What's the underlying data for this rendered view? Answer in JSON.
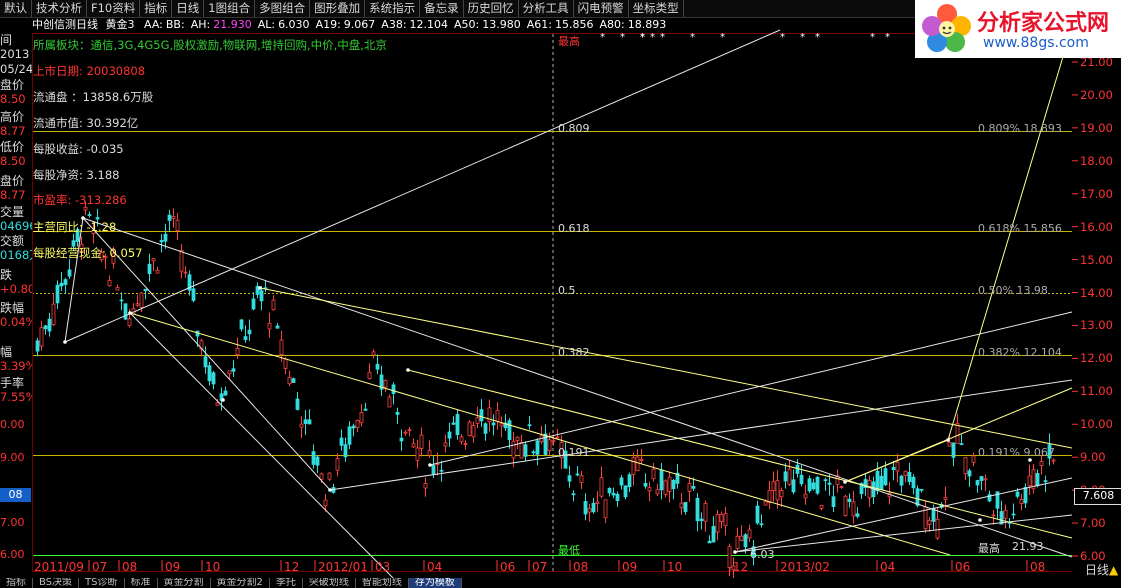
{
  "menu": [
    "默认",
    "技术分析",
    "F10资料",
    "指标",
    "日线",
    "1图组合",
    "多图组合",
    "图形叠加",
    "系统指示",
    "备忘录",
    "历史回忆",
    "分析工具",
    "闪电预警",
    "坐标类型"
  ],
  "title": {
    "stock": "中创信测",
    "period": "日线",
    "indicator": "黄金3",
    "params": [
      {
        "k": "AA:",
        "v": "BB:"
      },
      {
        "k": "AH:",
        "v": "21.930"
      },
      {
        "k": "AL:",
        "v": "6.030"
      },
      {
        "k": "A19:",
        "v": "9.067"
      },
      {
        "k": "A38:",
        "v": "12.104"
      },
      {
        "k": "A50:",
        "v": "13.980"
      },
      {
        "k": "A61:",
        "v": "15.856"
      },
      {
        "k": "A80:",
        "v": "18.893"
      }
    ]
  },
  "left_panel": [
    {
      "label": "间",
      "value": "2013"
    },
    {
      "label": "",
      "value": "05/24"
    },
    {
      "label": "盘价",
      "value": "8.50"
    },
    {
      "label": "高价",
      "value": "8.77"
    },
    {
      "label": "低价",
      "value": "8.50"
    },
    {
      "label": "盘价",
      "value": "8.77"
    },
    {
      "label": "交量",
      "value": "04696"
    },
    {
      "label": "交额",
      "value": "0168万"
    },
    {
      "label": "跌",
      "value": "+0.80"
    },
    {
      "label": "跌幅",
      "value": "0.04%"
    },
    {
      "label": "幅",
      "value": "3.39%"
    },
    {
      "label": "手率",
      "value": "7.55%"
    }
  ],
  "info": {
    "sector": "所属板块：通信,3G,4G5G,股权激励,物联网,增持回购,中价,中盘,北京",
    "listing_date_label": "上市日期:",
    "listing_date": "20030808",
    "float_shares": "流通盘   ：13858.6万股",
    "float_mv": "流通市值: 30.392亿",
    "eps": "每股收益: -0.035",
    "nav": "每股净资: 3.188",
    "pe": "市盈率: -313.286",
    "yoy": "主营同比: -1.28",
    "cfps": "每股经营现金: 0.057"
  },
  "markers": {
    "top": "最高",
    "bottom": "最低",
    "low_price": "6.03",
    "high_label": "最高",
    "high_value": "21.93"
  },
  "fib": [
    {
      "ratio": "0.809",
      "right": "0.809%  18.893",
      "price": 18.893
    },
    {
      "ratio": "0.618",
      "right": "0.618%  15.856",
      "price": 15.856
    },
    {
      "ratio": "0.5",
      "right": "0.50%  13.98",
      "price": 13.98
    },
    {
      "ratio": "0.382",
      "right": "0.382%  12.104",
      "price": 12.104
    },
    {
      "ratio": "0.191",
      "right": "0.191%  9.067",
      "price": 9.067
    }
  ],
  "last_price": "7.608",
  "left_axis_price": "08",
  "y_axis": [
    "21.00",
    "20.00",
    "19.00",
    "18.00",
    "17.00",
    "16.00",
    "15.00",
    "14.00",
    "13.00",
    "12.00",
    "11.00",
    "10.00",
    "9.00",
    "8.00",
    "7.00",
    "6.00"
  ],
  "left_y_labels": [
    "0.00",
    "9.00",
    "7.00",
    "6.00"
  ],
  "x_axis": [
    "2011/09",
    "07",
    "08",
    "09",
    "10",
    "12",
    "2012/01",
    "03",
    "04",
    "06",
    "07",
    "08",
    "09",
    "10",
    "12",
    "2013/02",
    "04",
    "06",
    "08"
  ],
  "period_label": "日线",
  "bottom_tabs": [
    "指标",
    "BS决策",
    "TS诊断",
    "标准",
    "黄金分割",
    "黄金分割2",
    "季托",
    "突破划线",
    "智能划线",
    "存为模板"
  ],
  "active_tab": "存为模板",
  "logo": {
    "title": "分析家公式网",
    "url": "www.88gs.com"
  },
  "colors": {
    "up": "#ff4444",
    "down": "#33dddd",
    "fib": "#c8b400",
    "axis": "#ff3333",
    "trend": "#ffff66"
  },
  "chart_data": {
    "type": "candlestick",
    "ylim": [
      6.0,
      22.0
    ],
    "x_range": [
      "2011/08",
      "2013/08"
    ],
    "fib_levels": [
      {
        "ratio": 0.809,
        "price": 18.893
      },
      {
        "ratio": 0.618,
        "price": 15.856
      },
      {
        "ratio": 0.5,
        "price": 13.98
      },
      {
        "ratio": 0.382,
        "price": 12.104
      },
      {
        "ratio": 0.191,
        "price": 9.067
      }
    ],
    "high": 21.93,
    "low": 6.03,
    "last_close": 7.608,
    "pivots": [
      {
        "date": "2011/08",
        "price": 12.5
      },
      {
        "date": "2011/09",
        "price": 16.3
      },
      {
        "date": "2011/10",
        "price": 13.4
      },
      {
        "date": "2011/11",
        "price": 16.2
      },
      {
        "date": "2011/12",
        "price": 10.8
      },
      {
        "date": "2012/01",
        "price": 14.1
      },
      {
        "date": "2012/02",
        "price": 8.0
      },
      {
        "date": "2012/03",
        "price": 11.7
      },
      {
        "date": "2012/04",
        "price": 8.7
      },
      {
        "date": "2012/05",
        "price": 10.4
      },
      {
        "date": "2012/06",
        "price": 9.5
      },
      {
        "date": "2012/07",
        "price": 9.7
      },
      {
        "date": "2012/08",
        "price": 7.5
      },
      {
        "date": "2012/09",
        "price": 8.5
      },
      {
        "date": "2012/10",
        "price": 7.9
      },
      {
        "date": "2012/12",
        "price": 6.03
      },
      {
        "date": "2013/01",
        "price": 8.3
      },
      {
        "date": "2013/03",
        "price": 7.7
      },
      {
        "date": "2013/04",
        "price": 8.6
      },
      {
        "date": "2013/05",
        "price": 7.1
      },
      {
        "date": "2013/06",
        "price": 9.6
      },
      {
        "date": "2013/07",
        "price": 7.2
      },
      {
        "date": "2013/08",
        "price": 9.0
      }
    ]
  }
}
